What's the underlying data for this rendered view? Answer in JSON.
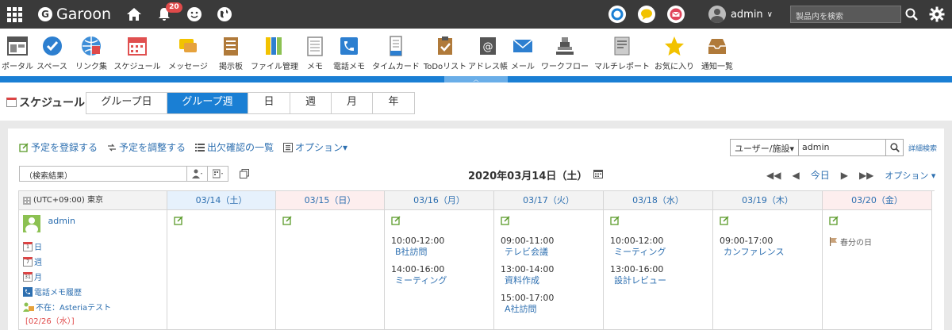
{
  "topbar": {
    "logo": "Garoon",
    "notification_count": "20",
    "user_name": "admin",
    "search_placeholder": "製品内を検索"
  },
  "apps": [
    {
      "label": "ポータル",
      "icon": "portal-icon"
    },
    {
      "label": "スペース",
      "icon": "space-icon"
    },
    {
      "label": "リンク集",
      "icon": "link-icon"
    },
    {
      "label": "スケジュール",
      "icon": "schedule-icon"
    },
    {
      "label": "メッセージ",
      "icon": "message-icon"
    },
    {
      "label": "掲示板",
      "icon": "bulletin-icon"
    },
    {
      "label": "ファイル管理",
      "icon": "file-icon"
    },
    {
      "label": "メモ",
      "icon": "memo-icon"
    },
    {
      "label": "電話メモ",
      "icon": "phone-memo-icon"
    },
    {
      "label": "タイムカード",
      "icon": "timecard-icon"
    },
    {
      "label": "ToDoリスト",
      "icon": "todo-icon"
    },
    {
      "label": "アドレス帳",
      "icon": "address-icon"
    },
    {
      "label": "メール",
      "icon": "mail-icon"
    },
    {
      "label": "ワークフロー",
      "icon": "workflow-icon"
    },
    {
      "label": "マルチレポート",
      "icon": "report-icon"
    },
    {
      "label": "お気に入り",
      "icon": "favorite-icon"
    },
    {
      "label": "通知一覧",
      "icon": "notification-list-icon"
    }
  ],
  "page": {
    "title": "スケジュール",
    "view_tabs": [
      "グループ日",
      "グループ週",
      "日",
      "週",
      "月",
      "年"
    ],
    "active_tab": "グループ週"
  },
  "actions": {
    "register": "予定を登録する",
    "adjust": "予定を調整する",
    "attendance": "出欠確認の一覧",
    "options": "オプション▾"
  },
  "user_filter": {
    "select": "ユーザー/施設▾",
    "value": "admin",
    "advanced": "詳細検索"
  },
  "search_result": "（検索結果）",
  "current_date": "2020年03月14日（土）",
  "nav": {
    "today": "今日",
    "options": "オプション ▾"
  },
  "grid": {
    "timezone": "(UTC+09:00) 東京",
    "days": [
      {
        "label": "03/14（土）",
        "type": "sat",
        "events": []
      },
      {
        "label": "03/15（日）",
        "type": "sun",
        "events": []
      },
      {
        "label": "03/16（月）",
        "type": "wk",
        "events": [
          {
            "time": "10:00-12:00",
            "name": "B社訪問"
          },
          {
            "time": "14:00-16:00",
            "name": "ミーティング"
          }
        ]
      },
      {
        "label": "03/17（火）",
        "type": "wk",
        "events": [
          {
            "time": "09:00-11:00",
            "name": "テレビ会議"
          },
          {
            "time": "13:00-14:00",
            "name": "資料作成"
          },
          {
            "time": "15:00-17:00",
            "name": "A社訪問"
          }
        ]
      },
      {
        "label": "03/18（水）",
        "type": "wk",
        "events": [
          {
            "time": "10:00-12:00",
            "name": "ミーティング"
          },
          {
            "time": "13:00-16:00",
            "name": "設計レビュー"
          }
        ]
      },
      {
        "label": "03/19（木）",
        "type": "wk",
        "events": [
          {
            "time": "09:00-17:00",
            "name": "カンファレンス"
          }
        ]
      },
      {
        "label": "03/20（金）",
        "type": "hol",
        "holiday": "春分の日",
        "events": []
      }
    ],
    "user": {
      "name": "admin",
      "links": [
        "日",
        "週",
        "月",
        "電話メモ履歴"
      ],
      "absent": "不在：Asteriaテスト",
      "absent_date": "[02/26（水）]"
    }
  }
}
